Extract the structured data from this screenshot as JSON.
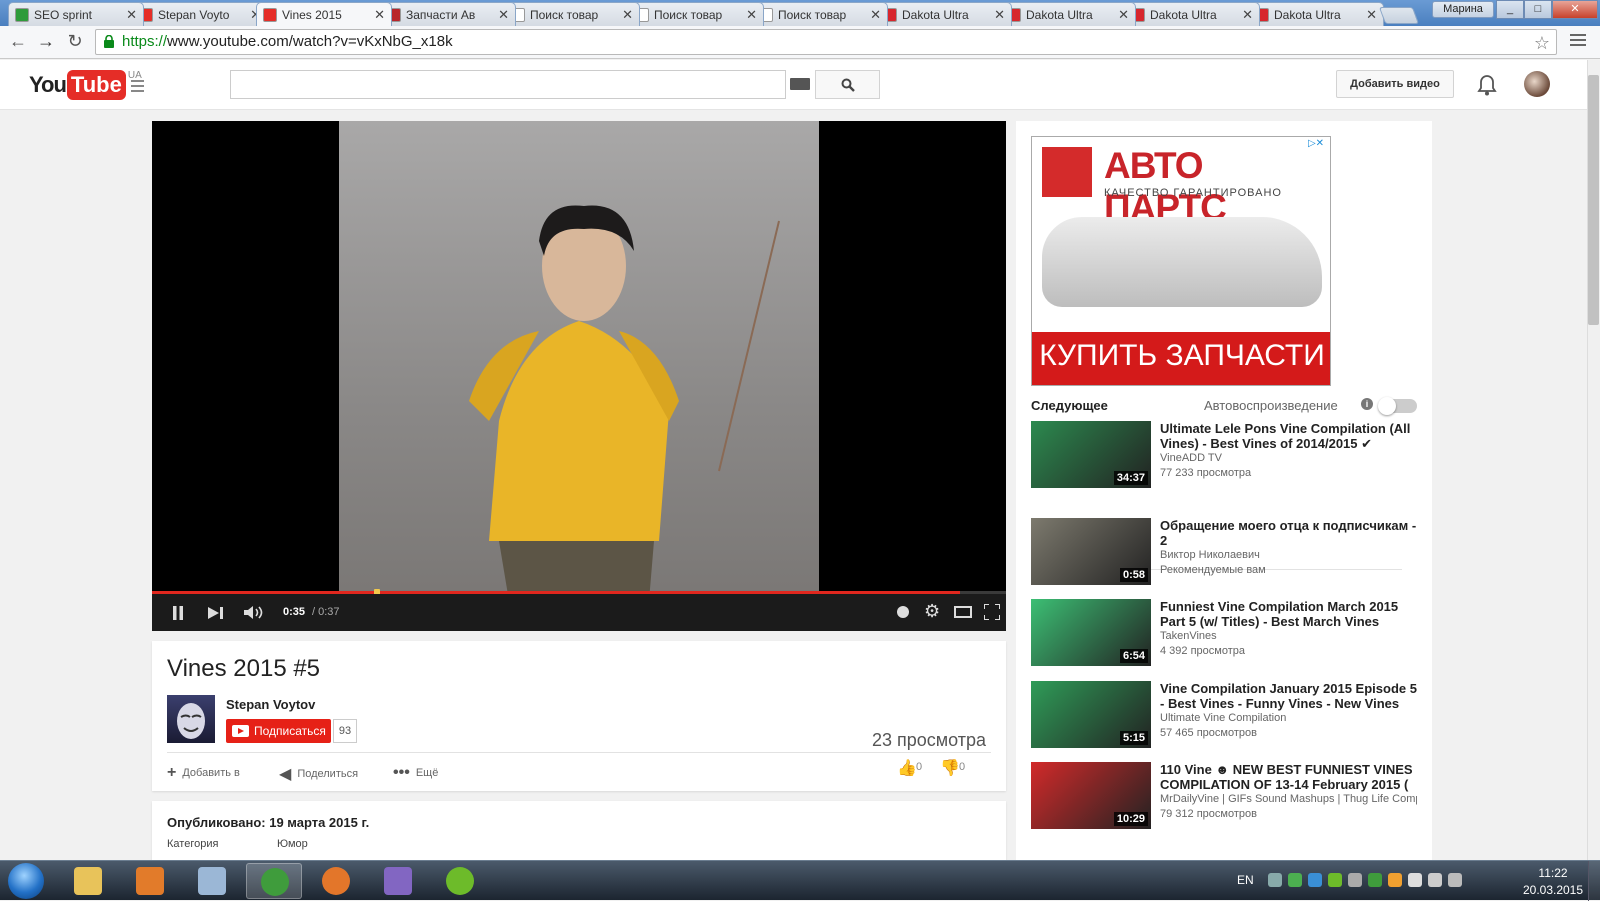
{
  "browser": {
    "tabs": [
      {
        "title": "SEO sprint",
        "icon": "seosprint-icon",
        "color": "#2e9b3a"
      },
      {
        "title": "Stepan Voyto",
        "icon": "youtube-icon",
        "color": "#e52d27"
      },
      {
        "title": "Vines 2015",
        "icon": "youtube-icon",
        "color": "#e52d27",
        "active": true
      },
      {
        "title": "Запчасти Ав",
        "icon": "autoparts-icon",
        "color": "#b8252c"
      },
      {
        "title": "Поиск товар",
        "icon": "page-icon",
        "color": "#ffffff"
      },
      {
        "title": "Поиск товар",
        "icon": "page-icon",
        "color": "#ffffff"
      },
      {
        "title": "Поиск товар",
        "icon": "page-icon",
        "color": "#ffffff"
      },
      {
        "title": "Dakota Ultra",
        "icon": "gear-red-icon",
        "color": "#d7262d"
      },
      {
        "title": "Dakota Ultra",
        "icon": "gear-red-icon",
        "color": "#d7262d"
      },
      {
        "title": "Dakota Ultra",
        "icon": "gear-red-icon",
        "color": "#d7262d"
      },
      {
        "title": "Dakota Ultra",
        "icon": "gear-red-icon",
        "color": "#d7262d"
      }
    ],
    "user": "Марина",
    "url_scheme": "https://",
    "url_rest": "www.youtube.com/watch?v=vKxNbG_x18k",
    "win_min": "_",
    "win_max": "□",
    "win_close": "✕"
  },
  "youtube": {
    "logo_you": "You",
    "logo_tube": "Tube",
    "logo_region": "UA",
    "upload_label": "Добавить видео"
  },
  "player": {
    "time_current": "0:35",
    "time_total": "/ 0:37",
    "progress": 0.946,
    "buffered_dot": 0.26
  },
  "video": {
    "title": "Vines 2015 #5",
    "channel": "Stepan Voytov",
    "subscribe_label": "Подписаться",
    "subscriber_count": "93",
    "views": "23 просмотра",
    "actions": {
      "add": "Добавить в",
      "share": "Поделиться",
      "more": "Ещё"
    },
    "likes": "0",
    "dislikes": "0",
    "published": "Опубликовано: 19 марта 2015 г.",
    "category_label": "Категория",
    "category_value": "Юмор"
  },
  "ad": {
    "brand": "АВТО ПАРТС",
    "tagline": "КАЧЕСТВО ГАРАНТИРОВАНО",
    "cta": "КУПИТЬ ЗАПЧАСТИ",
    "close": "▷✕"
  },
  "sidebar": {
    "next_label": "Следующее",
    "autoplay_label": "Автовоспроизведение",
    "autoplay_info": "i",
    "videos": [
      {
        "title": "Ultimate Lele Pons Vine Compilation (All Vines) - Best Vines of 2014/2015 ✔",
        "channel": "VineADD TV",
        "views": "77 233 просмотра",
        "duration": "34:37",
        "thumb_color": "#2c8a4f"
      },
      {
        "title": "Обращение моего отца к подписчикам - 2",
        "channel": "Виктор Николаевич",
        "views": "Рекомендуемые вам",
        "duration": "0:58",
        "thumb_color": "#7d7a6e"
      },
      {
        "title": "Funniest Vine Compilation March 2015 Part 5 (w/ Titles) - Best March Vines",
        "channel": "TakenVines",
        "views": "4 392 просмотра",
        "duration": "6:54",
        "thumb_color": "#3cbf74"
      },
      {
        "title": "Vine Compilation January 2015 Episode 5 - Best Vines - Funny Vines - New Vines",
        "channel": "Ultimate Vine Compilation",
        "views": "57 465 просмотров",
        "duration": "5:15",
        "thumb_color": "#2f9c58"
      },
      {
        "title": "110 Vine ☻ NEW BEST FUNNIEST VINES COMPILATION OF 13-14 February 2015 (",
        "channel": "MrDailyVine | GIFs Sound Mashups | Thug Life Comp",
        "views": "79 312 просмотров",
        "duration": "10:29",
        "thumb_color": "#d22a2a"
      }
    ]
  },
  "taskbar": {
    "lang": "EN",
    "time": "11:22",
    "date": "20.03.2015",
    "apps": [
      {
        "name": "explorer-icon",
        "color": "#e8c35a"
      },
      {
        "name": "media-player-icon",
        "color": "#e27b2a"
      },
      {
        "name": "calculator-icon",
        "color": "#9bb7d6"
      },
      {
        "name": "chrome-icon",
        "color": "#3f9c3c"
      },
      {
        "name": "firefox-icon",
        "color": "#e3762a"
      },
      {
        "name": "visual-studio-icon",
        "color": "#8266c2"
      },
      {
        "name": "utorrent-icon",
        "color": "#6dbb2a"
      }
    ]
  }
}
